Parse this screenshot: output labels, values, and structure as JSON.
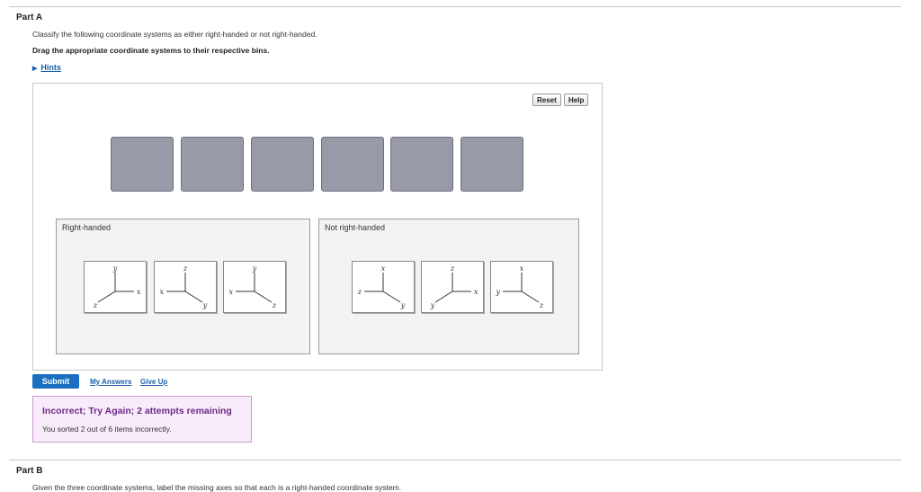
{
  "partA": {
    "title": "Part A",
    "instruction": "Classify the following coordinate systems as either right-handed or not right-handed.",
    "drag_instruction": "Drag the appropriate coordinate systems to their respective bins.",
    "hints_label": "Hints"
  },
  "toolbar": {
    "reset_label": "Reset",
    "help_label": "Help"
  },
  "slots_count": 6,
  "bins": [
    {
      "label": "Right-handed",
      "cards": [
        {
          "top": "y",
          "left": "",
          "right": "x",
          "diag": "z",
          "diag_dir": "down-left"
        },
        {
          "top": "z",
          "left": "x",
          "right": "",
          "diag": "y",
          "diag_dir": "down-right"
        },
        {
          "top": "y",
          "left": "x",
          "right": "",
          "diag": "z",
          "diag_dir": "down-right"
        }
      ]
    },
    {
      "label": "Not right-handed",
      "cards": [
        {
          "top": "x",
          "left": "z",
          "right": "",
          "diag": "y",
          "diag_dir": "down-right"
        },
        {
          "top": "z",
          "left": "",
          "right": "x",
          "diag": "y",
          "diag_dir": "down-left"
        },
        {
          "top": "x",
          "left": "y",
          "right": "",
          "diag": "z",
          "diag_dir": "down-right"
        }
      ]
    }
  ],
  "actions": {
    "submit_label": "Submit",
    "my_answers_label": "My Answers",
    "give_up_label": "Give Up"
  },
  "feedback": {
    "title": "Incorrect; Try Again; 2 attempts remaining",
    "message": "You sorted 2 out of 6 items incorrectly."
  },
  "partB": {
    "title": "Part B",
    "instruction": "Given the three coordinate systems, label the missing axes so that each is a right-handed coordinate system."
  },
  "colors": {
    "link": "#1a5fa8",
    "submit": "#1a6fc0",
    "slot": "#999aa8",
    "feedback_bg": "#f9ecfa",
    "feedback_title": "#6b2a86"
  }
}
